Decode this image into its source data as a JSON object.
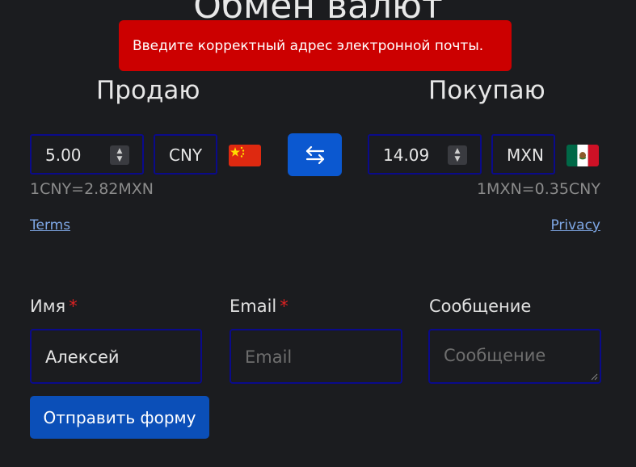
{
  "page": {
    "title": "Обмен валют"
  },
  "toast": {
    "message": "Введите корректный адрес электронной почты.",
    "color": "#cc0000"
  },
  "sell": {
    "heading": "Продаю",
    "amount": "5.00",
    "currency": "CNY",
    "flag_icon": "china-flag-icon",
    "rate": "1CNY=2.82MXN"
  },
  "buy": {
    "heading": "Покупаю",
    "amount": "14.09",
    "currency": "MXN",
    "flag_icon": "mexico-flag-icon",
    "rate": "1MXN=0.35CNY"
  },
  "swap": {
    "icon": "swap-arrows-icon",
    "color": "#0b58d0"
  },
  "links": {
    "terms": "Terms",
    "privacy": "Privacy"
  },
  "form": {
    "name": {
      "label": "Имя",
      "required_mark": "*",
      "value": "Алексей"
    },
    "email": {
      "label": "Email",
      "required_mark": "*",
      "placeholder": "Email"
    },
    "message": {
      "label": "Сообщение",
      "placeholder": "Сообщение"
    },
    "submit_label": "Отправить форму",
    "submit_color": "#0b4fb8"
  }
}
